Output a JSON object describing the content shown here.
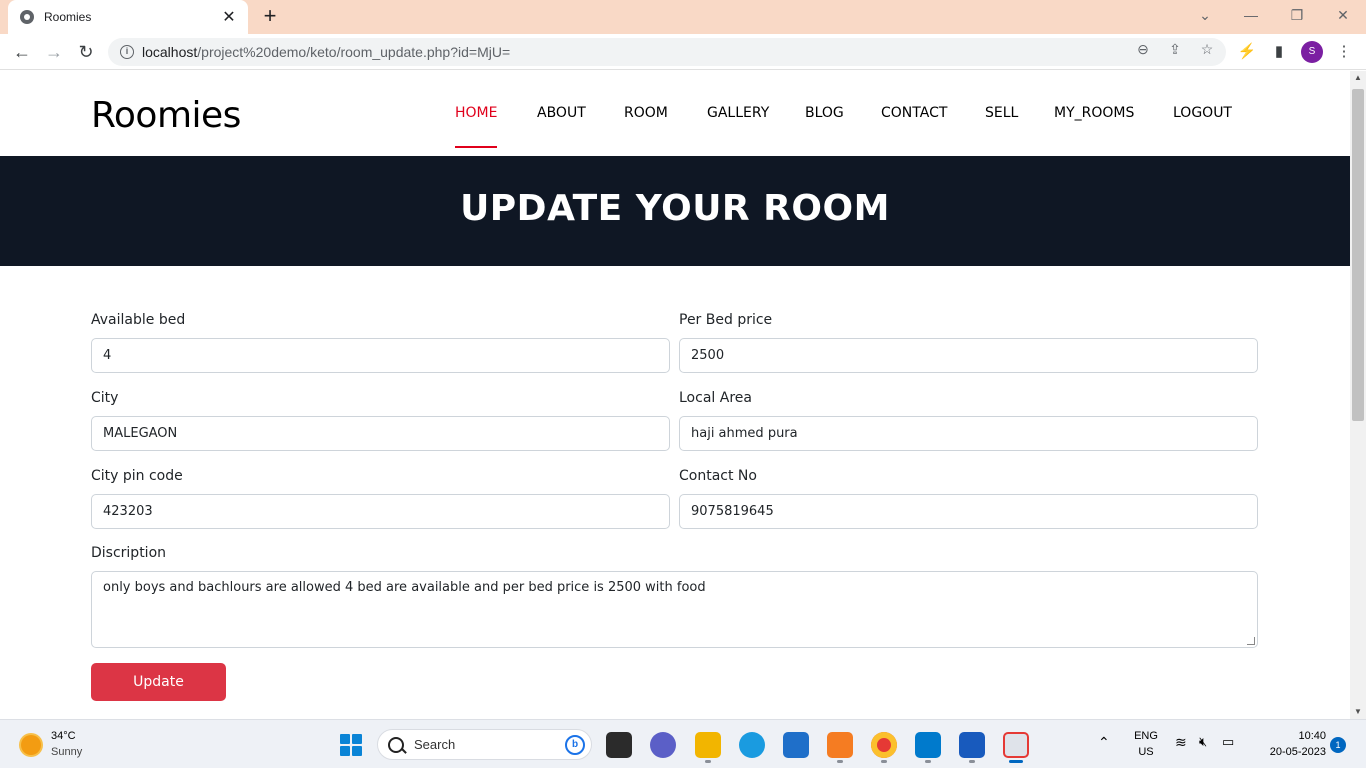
{
  "browser": {
    "tab_title": "Roomies",
    "tab_close": "✕",
    "new_tab": "+",
    "url_host": "localhost",
    "url_path": "/project%20demo/keto/room_update.php?id=MjU=",
    "profile_initial": "S",
    "profile_color": "#7b1fa2",
    "icons": [
      "back-arrow-icon",
      "forward-arrow-icon",
      "reload-icon",
      "site-info-icon",
      "zoom-icon",
      "share-icon",
      "bookmark-star-icon",
      "extensions-icon",
      "side-panel-icon",
      "kebab-menu-icon"
    ]
  },
  "site": {
    "brand": "Roomies",
    "nav": [
      "HOME",
      "ABOUT",
      "ROOM",
      "GALLERY",
      "BLOG",
      "CONTACT",
      "SELL",
      "MY_ROOMS",
      "LOGOUT"
    ],
    "active_nav": "HOME",
    "accent_color": "#e0001b",
    "hero_title": "UPDATE YOUR ROOM",
    "hero_bg": "#0f1724"
  },
  "form": {
    "available_bed": {
      "label": "Available bed",
      "value": "4"
    },
    "per_bed_price": {
      "label": "Per Bed price",
      "value": "2500"
    },
    "city": {
      "label": "City",
      "value": "MALEGAON"
    },
    "local_area": {
      "label": "Local Area",
      "value": "haji ahmed pura"
    },
    "city_pin": {
      "label": "City pin code",
      "value": "423203"
    },
    "contact_no": {
      "label": "Contact No",
      "value": "9075819645"
    },
    "description": {
      "label": "Discription",
      "value": "only boys and bachlours are allowed 4 bed are available and per bed price is 2500 with food"
    },
    "submit_label": "Update",
    "submit_color": "#dc3545"
  },
  "taskbar": {
    "weather_temp": "34°C",
    "weather_desc": "Sunny",
    "search_placeholder": "Search",
    "lang_line1": "ENG",
    "lang_line2": "US",
    "time": "10:40",
    "date": "20-05-2023",
    "notification_count": "1"
  }
}
